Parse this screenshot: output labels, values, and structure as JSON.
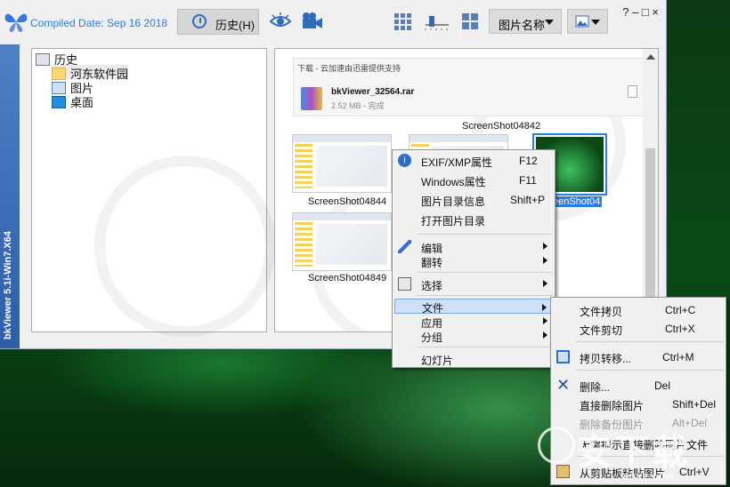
{
  "app": {
    "compiled_label": "Compiled Date: Sep 16 2018",
    "vertical_title": "bkViewer 5.1i-Win7.X64",
    "history_button": "历史(H)",
    "sort_dropdown": "图片名称",
    "window_buttons": "? – □ ×"
  },
  "tree": {
    "items": [
      {
        "label": "历史",
        "icon": "computer-icon"
      },
      {
        "label": "河东软件园",
        "icon": "folder-icon"
      },
      {
        "label": "图片",
        "icon": "pictures-icon"
      },
      {
        "label": "桌面",
        "icon": "desktop-icon"
      }
    ]
  },
  "download": {
    "header": "下载 - 云加速由迅雷提供支持",
    "filename": "bkViewer_32564.rar",
    "meta": "2.52 MB    -  完成"
  },
  "thumbnails": [
    {
      "caption": "ScreenShot04842"
    },
    {
      "caption": "ScreenShot04844"
    },
    {
      "caption": "eenShot04"
    },
    {
      "caption": "ScreenShot04849"
    }
  ],
  "context_menu": {
    "items": [
      {
        "label": "EXIF/XMP属性",
        "shortcut": "F12"
      },
      {
        "label": "Windows属性",
        "shortcut": "F11"
      },
      {
        "label": "图片目录信息",
        "shortcut": "Shift+P"
      },
      {
        "label": "打开图片目录",
        "shortcut": ""
      },
      {
        "label": "编辑",
        "shortcut": ""
      },
      {
        "label": "翻转",
        "shortcut": ""
      },
      {
        "label": "选择",
        "shortcut": ""
      },
      {
        "label": "文件",
        "shortcut": ""
      },
      {
        "label": "应用",
        "shortcut": ""
      },
      {
        "label": "分组",
        "shortcut": ""
      },
      {
        "label": "幻灯片",
        "shortcut": ""
      }
    ]
  },
  "file_submenu": {
    "items": [
      {
        "label": "文件拷贝",
        "shortcut": "Ctrl+C"
      },
      {
        "label": "文件剪切",
        "shortcut": "Ctrl+X"
      },
      {
        "label": "拷贝转移...",
        "shortcut": "Ctrl+M"
      },
      {
        "label": "删除...",
        "shortcut": "Del"
      },
      {
        "label": "直接删除图片",
        "shortcut": "Shift+Del"
      },
      {
        "label": "删除备份图片",
        "shortcut": "Alt+Del"
      },
      {
        "label": "无需提示直接删除图片文件",
        "shortcut": ""
      },
      {
        "label": "从剪贴板粘贴图片",
        "shortcut": "Ctrl+V"
      }
    ]
  },
  "watermark": {
    "big": "安下载",
    "small": "anxz.com"
  },
  "colors": {
    "accent": "#2a7de1",
    "sidebar": "#3f6fb8",
    "highlight": "#cce0f8"
  }
}
